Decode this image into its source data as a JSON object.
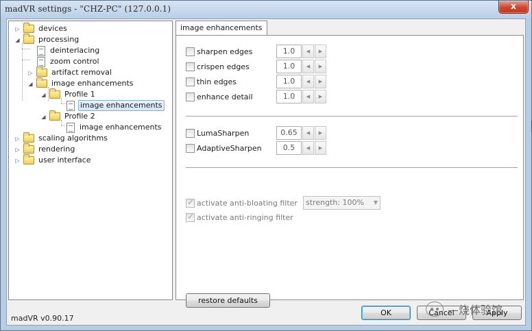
{
  "window": {
    "title": "madVR settings - \"CHZ-PC\" (127.0.0.1)",
    "close_glyph": "x",
    "version": "madVR v0.90.17"
  },
  "tree": {
    "items": [
      {
        "label": "devices",
        "icon": "folder-icon",
        "expander": "▷"
      },
      {
        "label": "processing",
        "icon": "folder-icon",
        "expander": "◢"
      },
      {
        "label": "deinterlacing",
        "icon": "page-icon"
      },
      {
        "label": "zoom control",
        "icon": "page-icon"
      },
      {
        "label": "artifact removal",
        "icon": "folder-icon",
        "expander": "▷"
      },
      {
        "label": "image enhancements",
        "icon": "folder-icon",
        "expander": "◢"
      },
      {
        "label": "Profile 1",
        "icon": "folder-icon",
        "expander": "◢"
      },
      {
        "label": "image enhancements",
        "icon": "page-icon",
        "selected": true
      },
      {
        "label": "Profile 2",
        "icon": "folder-icon",
        "expander": "◢"
      },
      {
        "label": "image enhancements",
        "icon": "page-icon"
      },
      {
        "label": "scaling algorithms",
        "icon": "folder-icon",
        "expander": "▷"
      },
      {
        "label": "rendering",
        "icon": "folder-icon",
        "expander": "▷"
      },
      {
        "label": "user interface",
        "icon": "folder-icon",
        "expander": "▷"
      }
    ]
  },
  "tab": {
    "label": "image enhancements"
  },
  "options": {
    "group1": [
      {
        "label": "sharpen edges",
        "value": "1.0",
        "checked": false
      },
      {
        "label": "crispen edges",
        "value": "1.0",
        "checked": false
      },
      {
        "label": "thin edges",
        "value": "1.0",
        "checked": false
      },
      {
        "label": "enhance detail",
        "value": "1.0",
        "checked": false
      }
    ],
    "group2": [
      {
        "label": "LumaSharpen",
        "value": "0.65",
        "checked": false
      },
      {
        "label": "AdaptiveSharpen",
        "value": "0.5",
        "checked": false
      }
    ],
    "group3": [
      {
        "label": "activate anti-bloating filter",
        "checked": true,
        "disabled": true
      },
      {
        "label": "activate anti-ringing filter",
        "checked": true,
        "disabled": true
      }
    ],
    "strength_combo": "strength: 100%",
    "spin_left": "◀",
    "spin_right": "▶"
  },
  "buttons": {
    "restore": "restore defaults",
    "ok": "OK",
    "cancel": "Cancel",
    "apply": "Apply"
  },
  "watermark": {
    "text": "—烧体验馆"
  }
}
